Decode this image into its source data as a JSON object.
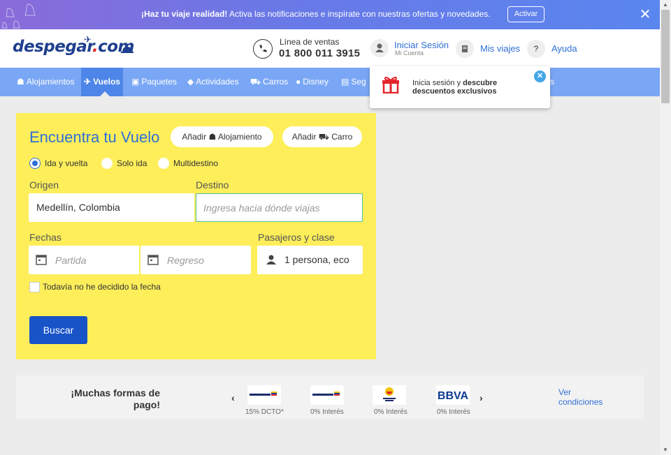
{
  "notification": {
    "bold": "¡Haz tu viaje realidad!",
    "text": " Activa las notificaciones e inspírate con nuestras ofertas y novedades.",
    "button": "Activar",
    "close_icon": "close-icon"
  },
  "header": {
    "logo_main": "despegar",
    "logo_dot": ".",
    "logo_suffix": "com",
    "sales_label": "Línea de ventas",
    "sales_phone": "01 800 011 3915",
    "login_label": "Iniciar Sesión",
    "login_sub": "Mi Cuenta",
    "trips_label": "Mis viajes",
    "help_icon": "?",
    "help_label": "Ayuda"
  },
  "nav": {
    "items": [
      {
        "label": "Alojamientos",
        "icon": "bed-icon"
      },
      {
        "label": "Vuelos",
        "icon": "plane-icon",
        "active": true
      },
      {
        "label": "Paquetes",
        "icon": "suitcase-icon"
      },
      {
        "label": "Actividades",
        "icon": "ticket-icon"
      },
      {
        "label": "Carros",
        "icon": "car-icon"
      },
      {
        "label": "Disney",
        "icon": "mickey-icon"
      },
      {
        "label": "Seg",
        "icon": "briefcase-icon"
      },
      {
        "label": "s",
        "icon": ""
      }
    ]
  },
  "tooltip": {
    "prefix": "Inicia sesión y ",
    "bold": "descubre descuentos exclusivos"
  },
  "search": {
    "title": "Encuentra tu Vuelo",
    "add_lodging": "Añadir",
    "add_lodging_b": "Alojamiento",
    "add_car": "Añadir",
    "add_car_b": "Carro",
    "trip_types": [
      "Ida y vuelta",
      "Solo ida",
      "Multidestino"
    ],
    "origin_label": "Origen",
    "origin_value": "Medellín, Colombia",
    "destination_label": "Destino",
    "destination_placeholder": "Ingresa hacia dónde viajas",
    "dates_label": "Fechas",
    "departure_placeholder": "Partida",
    "return_placeholder": "Regreso",
    "passengers_label": "Pasajeros y clase",
    "passengers_value": "1 persona, eco",
    "undecided_label": "Todavía no he decidido la fecha",
    "submit": "Buscar"
  },
  "payment": {
    "title_line1": "¡Muchas formas de",
    "title_line2": "pago!",
    "banks": [
      {
        "name": "Bancolombia",
        "caption": "15% DCTO*"
      },
      {
        "name": "Bancolombia",
        "caption": "0% Interés"
      },
      {
        "name": "Banco de Bogotá",
        "caption": "0% Interés"
      },
      {
        "name": "BBVA",
        "caption": "0% Interés"
      }
    ],
    "conditions_line1": "Ver",
    "conditions_line2": "condiciones"
  },
  "colors": {
    "brand_blue": "#2f6fd6",
    "nav_bg": "#7aa7f5",
    "panel_yellow": "#fdee5a",
    "button_blue": "#1854c7"
  }
}
